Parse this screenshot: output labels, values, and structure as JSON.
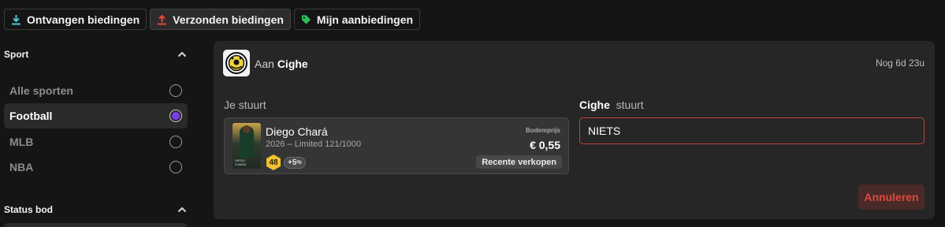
{
  "tabs": [
    {
      "label": "Ontvangen biedingen",
      "icon": "download-icon",
      "color": "#4fc3d9",
      "active": false
    },
    {
      "label": "Verzonden biedingen",
      "icon": "upload-icon",
      "color": "#e5483d",
      "active": true
    },
    {
      "label": "Mijn aanbiedingen",
      "icon": "price-tag-icon",
      "color": "#2fbf5a",
      "active": false
    }
  ],
  "sidebar": {
    "sport_heading": "Sport",
    "sport_options": [
      {
        "label": "Alle sporten",
        "selected": false
      },
      {
        "label": "Football",
        "selected": true
      },
      {
        "label": "MLB",
        "selected": false
      },
      {
        "label": "NBA",
        "selected": false
      }
    ],
    "status_heading": "Status bod"
  },
  "offer": {
    "to_prefix": "Aan",
    "recipient": "Cighe",
    "time_left": "Nog 6d 23u",
    "you_send_label": "Je stuurt",
    "they_send_name": "Cighe",
    "they_send_suffix": "stuurt",
    "card": {
      "player_name": "Diego Chará",
      "meta": "2026 – Limited 121/1000",
      "score": "48",
      "boost": "+5",
      "boost_unit": "%",
      "floor_label": "Bodemprijs",
      "price": "€ 0,55",
      "recent_sales": "Recente verkopen",
      "card_caption_line1": "DIEGO",
      "card_caption_line2": "CHARÁ"
    },
    "they_send_value": "NIETS",
    "cancel_label": "Annuleren"
  },
  "colors": {
    "accent_purple": "#7a3ee6",
    "danger": "#e0493e",
    "score_yellow": "#f2c230"
  }
}
